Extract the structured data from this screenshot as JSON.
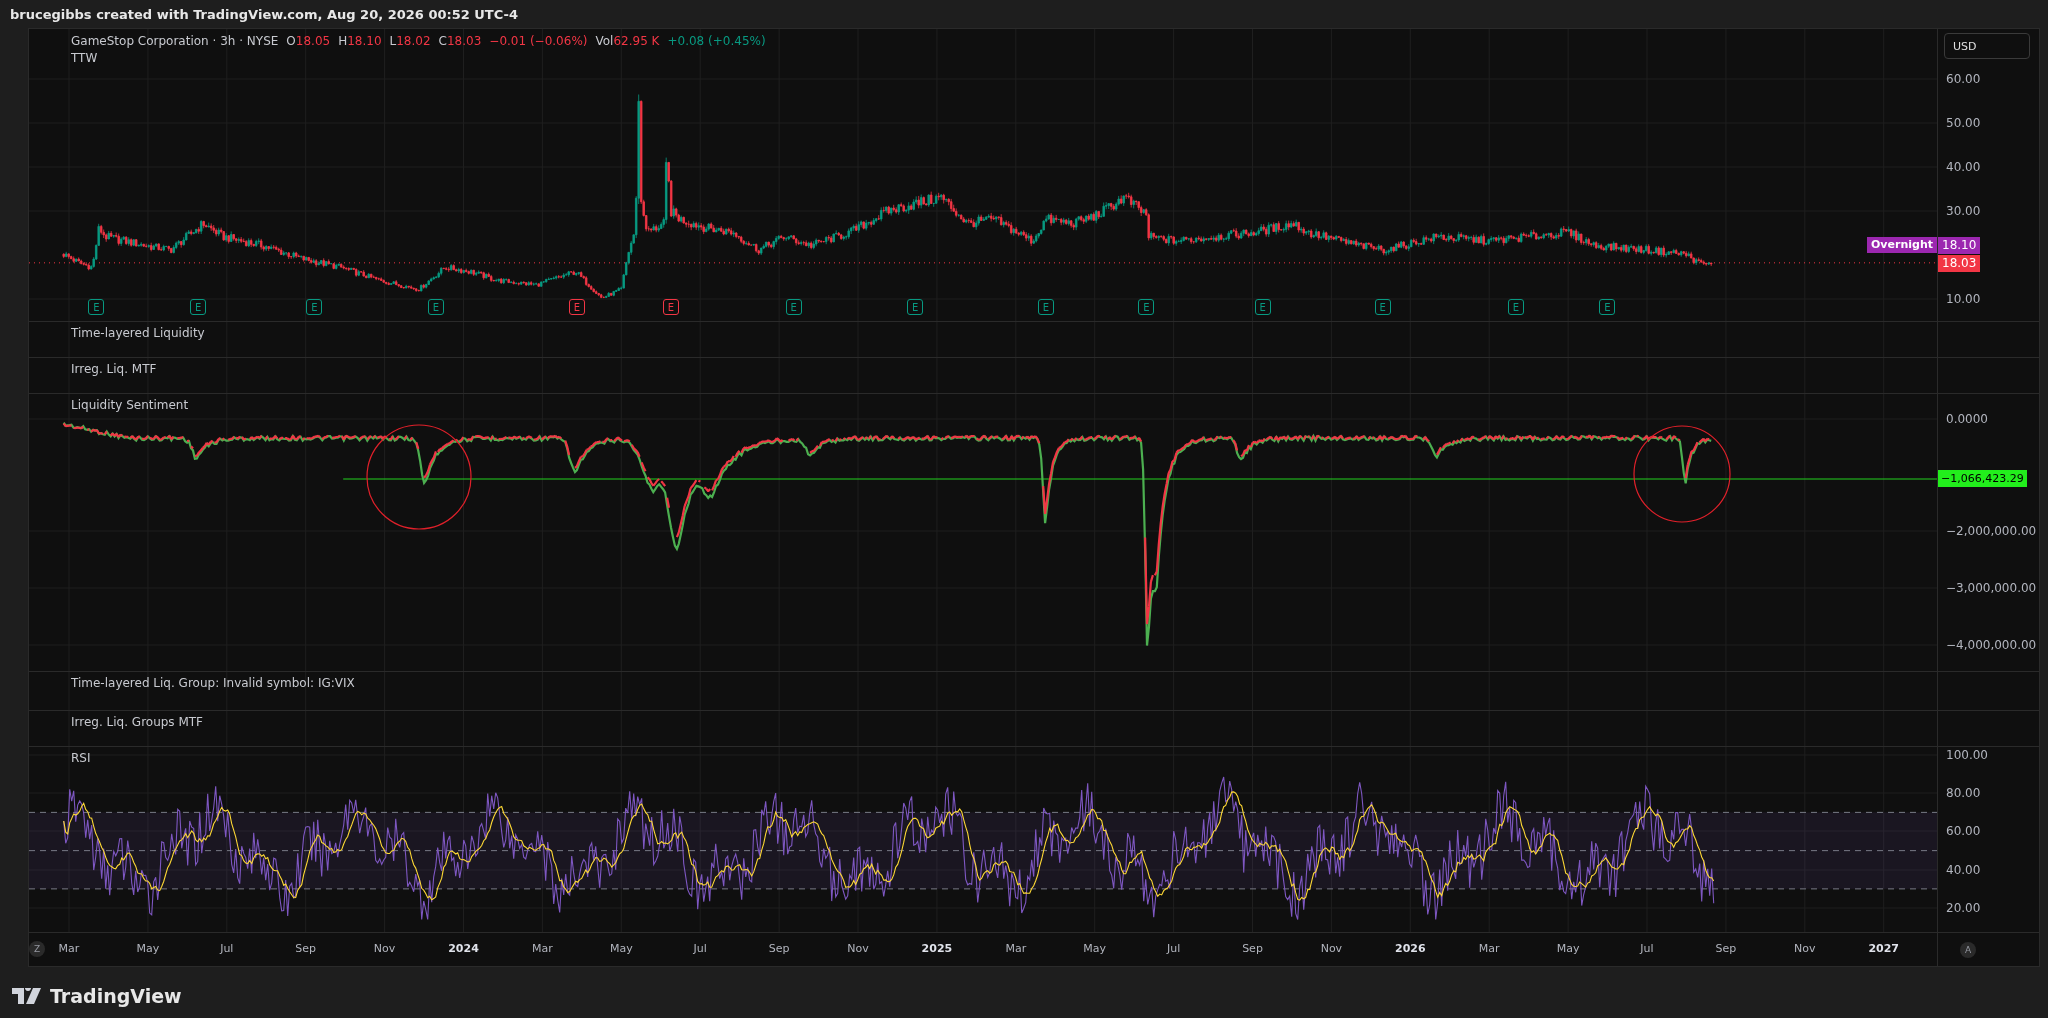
{
  "header": {
    "title": "brucegibbs created with TradingView.com, Aug 20, 2026 00:52 UTC-4"
  },
  "currency_button": {
    "label": "USD"
  },
  "panes": [
    {
      "kind": "price",
      "symbol": "GameStop Corporation · 3h · NYSE",
      "negative": true,
      "ohlc": [
        {
          "label": "O",
          "value": "18.05"
        },
        {
          "label": "H",
          "value": "18.10"
        },
        {
          "label": "L",
          "value": "18.02"
        },
        {
          "label": "C",
          "value": "18.03"
        }
      ],
      "change": "−0.01 (−0.06%)",
      "volume": {
        "label": "Vol",
        "value": "62.95 K",
        "change": "+0.08 (+0.45%)",
        "negative": false
      },
      "indicator": "TTW",
      "axis_ticks": [
        "60.00",
        "50.00",
        "40.00",
        "30.00",
        "10.00"
      ],
      "session_tag": {
        "label": "Overnight",
        "price": "18.10"
      },
      "last_price": "18.03",
      "earnings": [
        {
          "label": "E",
          "color": "#089981"
        },
        {
          "label": "E",
          "color": "#089981"
        },
        {
          "label": "E",
          "color": "#089981"
        },
        {
          "label": "E",
          "color": "#089981"
        },
        {
          "label": "E",
          "color": "#f23645"
        },
        {
          "label": "E",
          "color": "#f23645"
        },
        {
          "label": "E",
          "color": "#089981"
        },
        {
          "label": "E",
          "color": "#089981"
        },
        {
          "label": "E",
          "color": "#089981"
        },
        {
          "label": "E",
          "color": "#089981"
        },
        {
          "label": "E",
          "color": "#089981"
        },
        {
          "label": "E",
          "color": "#089981"
        },
        {
          "label": "E",
          "color": "#089981"
        },
        {
          "label": "E",
          "color": "#089981"
        }
      ]
    },
    {
      "kind": "empty",
      "title": "Time-layered Liquidity"
    },
    {
      "kind": "empty",
      "title": "Irreg. Liq. MTF"
    },
    {
      "kind": "sentiment",
      "title": "Liquidity Sentiment",
      "axis_ticks": [
        "0.0000",
        "−2,000,000.00",
        "−3,000,000.00",
        "−4,000,000.00"
      ],
      "level_label": "−1,066,423.29"
    },
    {
      "kind": "empty",
      "title": "Time-layered Liq. Group: Invalid symbol: IG:VIX"
    },
    {
      "kind": "empty",
      "title": "Irreg. Liq. Groups MTF"
    },
    {
      "kind": "rsi",
      "title": "RSI",
      "axis_ticks": [
        "100.00",
        "80.00",
        "60.00",
        "40.00",
        "20.00"
      ]
    }
  ],
  "time_axis": {
    "left_button": "Z",
    "right_button": "A",
    "labels": [
      {
        "label": "Mar",
        "kind": "month"
      },
      {
        "label": "May",
        "kind": "month"
      },
      {
        "label": "Jul",
        "kind": "month"
      },
      {
        "label": "Sep",
        "kind": "month"
      },
      {
        "label": "Nov",
        "kind": "month"
      },
      {
        "label": "2024",
        "kind": "year"
      },
      {
        "label": "Mar",
        "kind": "month"
      },
      {
        "label": "May",
        "kind": "month"
      },
      {
        "label": "Jul",
        "kind": "month"
      },
      {
        "label": "Sep",
        "kind": "month"
      },
      {
        "label": "Nov",
        "kind": "month"
      },
      {
        "label": "2025",
        "kind": "year"
      },
      {
        "label": "Mar",
        "kind": "month"
      },
      {
        "label": "May",
        "kind": "month"
      },
      {
        "label": "Jul",
        "kind": "month"
      },
      {
        "label": "Sep",
        "kind": "month"
      },
      {
        "label": "Nov",
        "kind": "month"
      },
      {
        "label": "2026",
        "kind": "year"
      },
      {
        "label": "Mar",
        "kind": "month"
      },
      {
        "label": "May",
        "kind": "month"
      },
      {
        "label": "Jul",
        "kind": "month"
      },
      {
        "label": "Sep",
        "kind": "month"
      },
      {
        "label": "Nov",
        "kind": "month"
      },
      {
        "label": "2027",
        "kind": "year"
      }
    ]
  },
  "footer": {
    "brand": "TradingView"
  }
}
